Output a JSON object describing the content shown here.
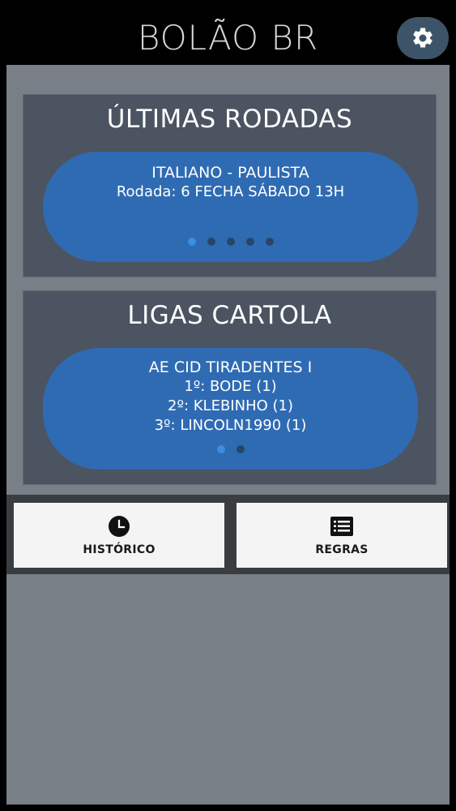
{
  "header": {
    "title": "BOLÃO BR",
    "settings_icon": "gear-icon"
  },
  "ultimas_rodadas": {
    "title": "ÚLTIMAS RODADAS",
    "pill": {
      "line1": "ITALIANO - PAULISTA",
      "line2": "Rodada: 6 FECHA SÁBADO 13H"
    },
    "pager": {
      "count": 5,
      "active_index": 0
    }
  },
  "ligas_cartola": {
    "title": "LIGAS CARTOLA",
    "pill": {
      "line1": "AE CID TIRADENTES I",
      "line2": "1º: BODE (1)",
      "line3": "2º: KLEBINHO (1)",
      "line4": "3º: LINCOLN1990 (1)"
    },
    "pager": {
      "count": 2,
      "active_index": 0
    }
  },
  "actions": {
    "historico": {
      "label": "HISTÓRICO",
      "icon": "clock-icon"
    },
    "regras": {
      "label": "REGRAS",
      "icon": "list-icon"
    }
  },
  "colors": {
    "background": "#000000",
    "content_bg": "#787f86",
    "card_bg": "#4b5460",
    "pill_bg": "#2f6bb3",
    "dot_active": "#3a8fe0",
    "dot_inactive": "#27456b",
    "settings_bg": "#3d5468"
  }
}
